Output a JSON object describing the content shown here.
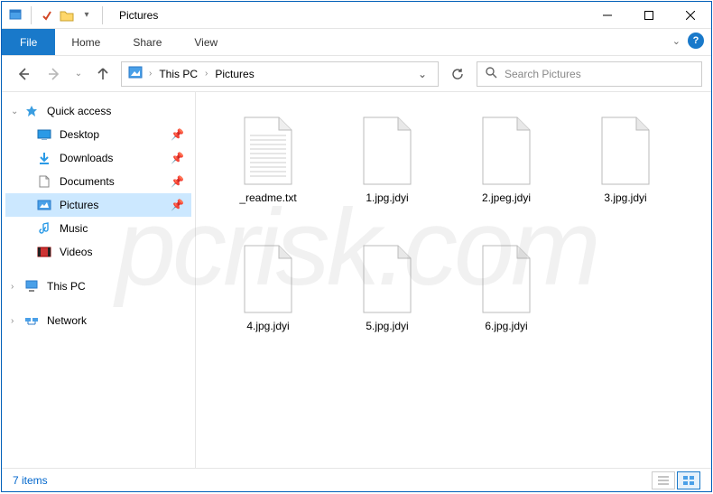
{
  "window": {
    "title": "Pictures"
  },
  "tabs": {
    "file": "File",
    "home": "Home",
    "share": "Share",
    "view": "View"
  },
  "breadcrumb": [
    "This PC",
    "Pictures"
  ],
  "search": {
    "placeholder": "Search Pictures"
  },
  "sidebar": {
    "quick": {
      "label": "Quick access",
      "items": [
        {
          "label": "Desktop",
          "pinned": true,
          "icon": "desktop"
        },
        {
          "label": "Downloads",
          "pinned": true,
          "icon": "downloads"
        },
        {
          "label": "Documents",
          "pinned": true,
          "icon": "documents"
        },
        {
          "label": "Pictures",
          "pinned": true,
          "icon": "pictures",
          "selected": true
        },
        {
          "label": "Music",
          "pinned": false,
          "icon": "music"
        },
        {
          "label": "Videos",
          "pinned": false,
          "icon": "videos"
        }
      ]
    },
    "thispc": {
      "label": "This PC"
    },
    "network": {
      "label": "Network"
    }
  },
  "files": [
    {
      "name": "_readme.txt",
      "type": "text"
    },
    {
      "name": "1.jpg.jdyi",
      "type": "blank"
    },
    {
      "name": "2.jpeg.jdyi",
      "type": "blank"
    },
    {
      "name": "3.jpg.jdyi",
      "type": "blank"
    },
    {
      "name": "4.jpg.jdyi",
      "type": "blank"
    },
    {
      "name": "5.jpg.jdyi",
      "type": "blank"
    },
    {
      "name": "6.jpg.jdyi",
      "type": "blank"
    }
  ],
  "status": {
    "count": "7 items"
  },
  "watermark": "pcrisk.com"
}
